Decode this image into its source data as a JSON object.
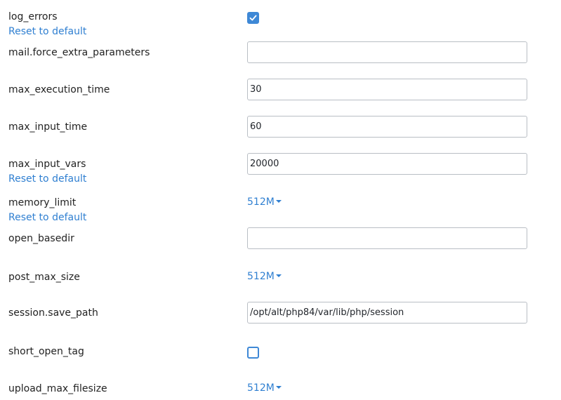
{
  "settings": {
    "reset_label": "Reset to default",
    "log_errors": {
      "name": "log_errors",
      "checked": true
    },
    "mail_force_extra_parameters": {
      "name": "mail.force_extra_parameters",
      "value": ""
    },
    "max_execution_time": {
      "name": "max_execution_time",
      "value": "30"
    },
    "max_input_time": {
      "name": "max_input_time",
      "value": "60"
    },
    "max_input_vars": {
      "name": "max_input_vars",
      "value": "20000"
    },
    "memory_limit": {
      "name": "memory_limit",
      "value": "512M"
    },
    "open_basedir": {
      "name": "open_basedir",
      "value": ""
    },
    "post_max_size": {
      "name": "post_max_size",
      "value": "512M"
    },
    "session_save_path": {
      "name": "session.save_path",
      "value": "/opt/alt/php84/var/lib/php/session"
    },
    "short_open_tag": {
      "name": "short_open_tag",
      "checked": false
    },
    "upload_max_filesize": {
      "name": "upload_max_filesize",
      "value": "512M"
    }
  },
  "colors": {
    "link": "#2f7fd1",
    "checkbox": "#3e88d6",
    "border": "#b9bec4"
  }
}
